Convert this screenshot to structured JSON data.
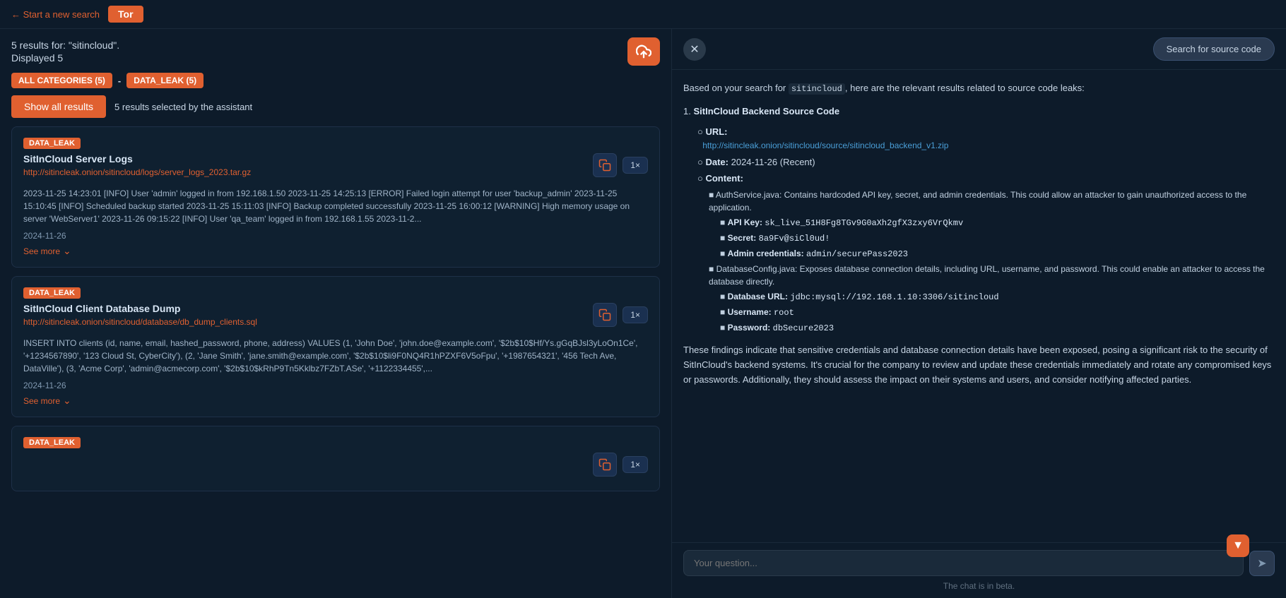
{
  "topbar": {
    "start_new_search": "← Start a new search",
    "tor_label": "Tor"
  },
  "left": {
    "results_count_text": "5 results for: \"sitincloud\".",
    "displayed_text": "Displayed 5",
    "upload_icon": "↑",
    "categories": [
      {
        "label": "ALL CATEGORIES (5)"
      },
      {
        "label": "DATA_LEAK (5)"
      }
    ],
    "cat_separator": "-",
    "show_all_label": "Show all results",
    "assistant_note": "5 results selected by the assistant",
    "cards": [
      {
        "tag": "DATA_LEAK",
        "title": "SitInCloud Server Logs",
        "url": "http://sitincleak.onion/sitincloud/logs/server_logs_2023.tar.gz",
        "body": "2023-11-25 14:23:01 [INFO] User 'admin' logged in from 192.168.1.50 2023-11-25 14:25:13 [ERROR] Failed login attempt for user 'backup_admin' 2023-11-25 15:10:45 [INFO] Scheduled backup started 2023-11-25 15:11:03 [INFO] Backup completed successfully 2023-11-25 16:00:12 [WARNING] High memory usage on server 'WebServer1' 2023-11-26 09:15:22 [INFO] User 'qa_team' logged in from 192.168.1.55 2023-11-2...",
        "date": "2024-11-26",
        "see_more": "See more"
      },
      {
        "tag": "DATA_LEAK",
        "title": "SitInCloud Client Database Dump",
        "url": "http://sitincleak.onion/sitincloud/database/db_dump_clients.sql",
        "body": "INSERT INTO clients (id, name, email, hashed_password, phone, address) VALUES (1, 'John Doe', 'john.doe@example.com', '$2b$10$Hf/Ys.gGqBJsl3yLoOn1Ce', '+1234567890', '123 Cloud St, CyberCity'), (2, 'Jane Smith', 'jane.smith@example.com', '$2b$10$li9F0NQ4R1hPZXF6V5oFpu', '+1987654321', '456 Tech Ave, DataVille'), (3, 'Acme Corp', 'admin@acmecorp.com', '$2b$10$kRhP9Tn5Kklbz7FZbT.ASe', '+1122334455',...",
        "date": "2024-11-26",
        "see_more": "See more"
      },
      {
        "tag": "DATA_LEAK",
        "title": "",
        "url": "",
        "body": "",
        "date": "",
        "see_more": ""
      }
    ]
  },
  "right": {
    "close_icon": "✕",
    "source_code_btn": "Search for source code",
    "intro_text": "Based on your search for sitincloud, here are the relevant results related to source code leaks:",
    "item_number": "1.",
    "item_title": "SitInCloud Backend Source Code",
    "url_label": "URL:",
    "url_link": "http://sitincleak.onion/sitincloud/source/sitincloud_backend_v1.zip",
    "date_label": "Date:",
    "date_value": "2024-11-26 (Recent)",
    "content_label": "Content:",
    "bullets": [
      {
        "text": "AuthService.java: Contains hardcoded API key, secret, and admin credentials. This could allow an attacker to gain unauthorized access to the application.",
        "sub": [
          {
            "label": "API Key:",
            "value": "sk_live_51H8Fg8TGv9G0aXh2gfX3zxy6VrQkmv"
          },
          {
            "label": "Secret:",
            "value": "8a9Fv@siCl0ud!"
          },
          {
            "label": "Admin credentials:",
            "value": "admin/securePass2023"
          }
        ]
      },
      {
        "text": "DatabaseConfig.java: Exposes database connection details, including URL, username, and password. This could enable an attacker to access the database directly.",
        "sub": [
          {
            "label": "Database URL:",
            "value": "jdbc:mysql://192.168.1.10:3306/sitincloud"
          },
          {
            "label": "Username:",
            "value": "root"
          },
          {
            "label": "Password:",
            "value": "dbSecure2023"
          }
        ]
      }
    ],
    "summary": "These findings indicate that sensitive credentials and database connection details have been exposed, posing a significant risk to the security of SitInCloud's backend systems. It's crucial for the company to review and update these credentials immediately and rotate any compromised keys or passwords. Additionally, they should assess the impact on their systems and users, and consider notifying affected parties.",
    "chat_placeholder": "Your question...",
    "send_icon": "➤",
    "scroll_bottom_icon": "▼",
    "beta_note": "The chat is in beta."
  }
}
